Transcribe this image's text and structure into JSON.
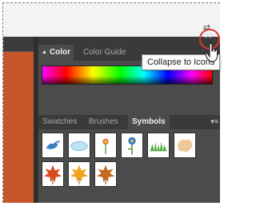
{
  "workspace": {
    "dock_icon": "dock-arrows-icon"
  },
  "color_panel": {
    "tabs": [
      {
        "label": "Color",
        "active": true
      },
      {
        "label": "Color Guide",
        "active": false
      }
    ],
    "swatches": [
      "none",
      "#ffffff",
      "#000000"
    ]
  },
  "lower_panel": {
    "tabs": [
      {
        "label": "Swatches",
        "active": false
      },
      {
        "label": "Brushes",
        "active": false
      },
      {
        "label": "Symbols",
        "active": true
      }
    ],
    "menu_icon": "panel-menu-icon",
    "symbols": [
      {
        "name": "blue-bird",
        "color": "#3a7fc4"
      },
      {
        "name": "cloud",
        "color": "#9fd0ea"
      },
      {
        "name": "flower-small",
        "color": "#e07a3a"
      },
      {
        "name": "blue-flower",
        "color": "#2f78c9"
      },
      {
        "name": "grass",
        "color": "#4fa63a"
      },
      {
        "name": "splat",
        "color": "#f0c99a"
      },
      {
        "name": "leaf-red",
        "color": "#d94c1e"
      },
      {
        "name": "leaf-orange",
        "color": "#f0a21e"
      },
      {
        "name": "leaf-brown",
        "color": "#c46a1e"
      }
    ]
  },
  "tooltip": {
    "text": "Collapse to Icons"
  },
  "colors": {
    "highlight": "#d93a2b",
    "panel_bg": "#4b4b4b",
    "tab_bar": "#3a3a3a"
  }
}
